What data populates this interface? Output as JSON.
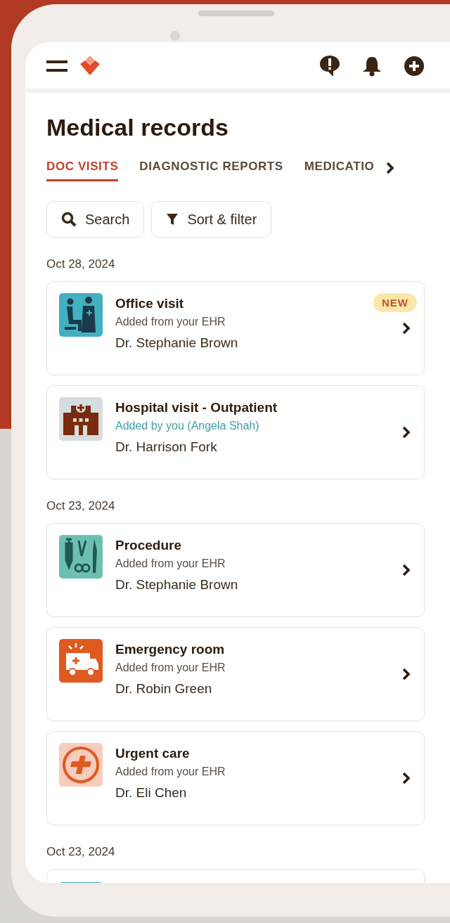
{
  "title": "Medical records",
  "tabs": [
    {
      "label": "DOC VISITS",
      "selected": true
    },
    {
      "label": "DIAGNOSTIC REPORTS",
      "selected": false
    },
    {
      "label": "MEDICATIO",
      "selected": false
    }
  ],
  "actions": [
    {
      "kind": "search",
      "label": "Search"
    },
    {
      "kind": "filter",
      "label": "Sort & filter"
    }
  ],
  "sections": [
    {
      "date": "Oct 28, 2024",
      "visits": [
        {
          "kind": "office",
          "title": "Office visit",
          "source": "Added from your EHR",
          "added_by_user": false,
          "doctor": "Dr. Stephanie Brown",
          "badge": "NEW"
        },
        {
          "kind": "hospital",
          "title": "Hospital visit - Outpatient",
          "source": "Added by you (Angela Shah)",
          "added_by_user": true,
          "doctor": "Dr. Harrison Fork"
        }
      ]
    },
    {
      "date": "Oct 23, 2024",
      "visits": [
        {
          "kind": "procedure",
          "title": "Procedure",
          "source": "Added from your EHR",
          "added_by_user": false,
          "doctor": "Dr. Stephanie Brown"
        },
        {
          "kind": "emergency",
          "title": "Emergency room",
          "source": "Added from your EHR",
          "added_by_user": false,
          "doctor": "Dr. Robin Green"
        },
        {
          "kind": "urgent",
          "title": "Urgent care",
          "source": "Added from your EHR",
          "added_by_user": false,
          "doctor": "Dr. Eli Chen"
        }
      ]
    },
    {
      "date": "Oct 23, 2024",
      "more_below": true
    }
  ]
}
